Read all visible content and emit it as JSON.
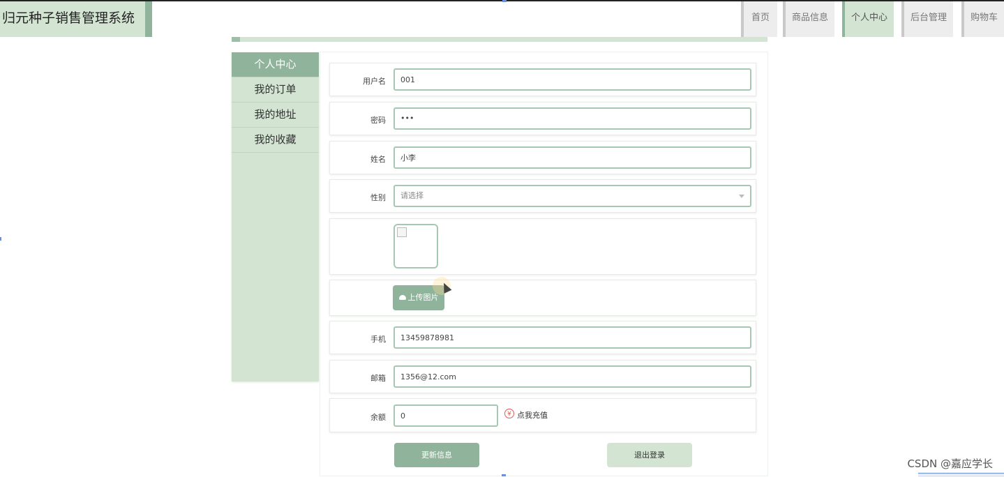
{
  "header": {
    "brand": "归元种子销售管理系统",
    "nav": [
      {
        "label": "首页",
        "active": false
      },
      {
        "label": "商品信息",
        "active": false
      },
      {
        "label": "个人中心",
        "active": true
      },
      {
        "label": "后台管理",
        "active": false
      },
      {
        "label": "购物车",
        "active": false
      }
    ]
  },
  "sidebar": {
    "items": [
      {
        "label": "个人中心",
        "active": true
      },
      {
        "label": "我的订单",
        "active": false
      },
      {
        "label": "我的地址",
        "active": false
      },
      {
        "label": "我的收藏",
        "active": false
      }
    ]
  },
  "form": {
    "username": {
      "label": "用户名",
      "value": "001"
    },
    "password": {
      "label": "密码",
      "value": "•••"
    },
    "name": {
      "label": "姓名",
      "value": "小李"
    },
    "gender": {
      "label": "性别",
      "placeholder": "请选择"
    },
    "upload": {
      "label": "上传图片"
    },
    "phone": {
      "label": "手机",
      "value": "13459878981"
    },
    "email": {
      "label": "邮箱",
      "value": "1356@12.com"
    },
    "balance": {
      "label": "余额",
      "value": "0",
      "recharge_label": "点我充值",
      "recharge_icon_glyph": "¥"
    }
  },
  "buttons": {
    "update": "更新信息",
    "logout": "退出登录"
  },
  "watermark": "CSDN @嘉应学长",
  "colors": {
    "accent": "#8fb39b",
    "light": "#d3e4d3",
    "recharge": "#e05a4f"
  }
}
